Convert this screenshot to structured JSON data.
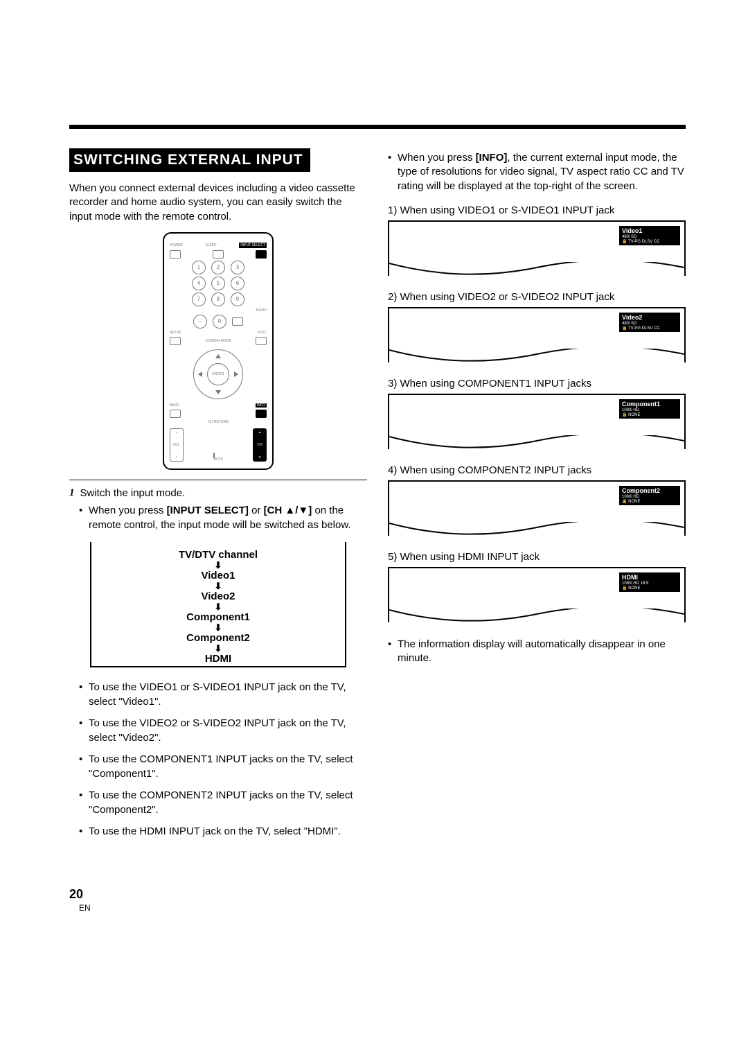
{
  "section_title": "SWITCHING EXTERNAL INPUT",
  "intro": "When you connect external devices including a video cassette recorder and home audio system, you can easily switch the input mode with the remote control.",
  "remote_labels": {
    "power": "POWER",
    "sleep": "SLEEP",
    "input_select": "INPUT SELECT",
    "audio": "AUDIO",
    "still": "STILL",
    "setup": "SETUP",
    "screen_mode": "SCREEN MODE",
    "enter": "ENTER",
    "back": "BACK",
    "info": "INFO",
    "ch_return": "CH RETURN",
    "vol": "VOL.",
    "mute": "MUTE",
    "ch": "CH"
  },
  "step1": "Switch the input mode.",
  "step1_bullet_prefix": "When you press ",
  "step1_bullet_bold1": "[INPUT SELECT]",
  "step1_bullet_mid": " or ",
  "step1_bullet_bold2": "[CH ▲/▼]",
  "step1_bullet_suffix": " on the remote control, the input mode will be switched as below.",
  "flow": {
    "n0": "TV/DTV channel",
    "n1": "Video1",
    "n2": "Video2",
    "n3": "Component1",
    "n4": "Component2",
    "n5": "HDMI"
  },
  "usage_bullets": [
    "To use the VIDEO1 or S-VIDEO1 INPUT jack on the TV, select \"Video1\".",
    "To use the VIDEO2 or S-VIDEO2 INPUT jack on the TV, select \"Video2\".",
    "To use the COMPONENT1 INPUT jacks on the TV, select \"Component1\".",
    "To use the COMPONENT2 INPUT jacks on the TV, select \"Component2\".",
    "To use the HDMI INPUT jack on the TV, select \"HDMI\"."
  ],
  "info_bullet_prefix": "When you press ",
  "info_bullet_bold": "[INFO]",
  "info_bullet_suffix": ", the current external input mode, the type of resolutions for video signal, TV aspect ratio CC and TV rating will be displayed at the top-right of the screen.",
  "cases": [
    {
      "label": "1) When using VIDEO1 or S-VIDEO1 INPUT jack",
      "title": "Video1",
      "line1": "480i    SD",
      "line2": "🔒 TV-PG DLSV  CC"
    },
    {
      "label": "2) When using VIDEO2 or S-VIDEO2 INPUT jack",
      "title": "Video2",
      "line1": "480i    SD",
      "line2": "🔒 TV-PG DLSV  CC"
    },
    {
      "label": "3) When using COMPONENT1 INPUT jacks",
      "title": "Component1",
      "line1": "1080i    HD",
      "line2": "🔒 NONE"
    },
    {
      "label": "4) When using COMPONENT2 INPUT jacks",
      "title": "Component2",
      "line1": "1080i    HD",
      "line2": "🔒 NONE"
    },
    {
      "label": "5) When using HDMI INPUT jack",
      "title": "HDMI",
      "line1": "1080i   HD   16:9",
      "line2": "🔒 NONE"
    }
  ],
  "auto_disappear": "The information display will automatically disappear in one minute.",
  "page_number": "20",
  "page_lang": "EN"
}
